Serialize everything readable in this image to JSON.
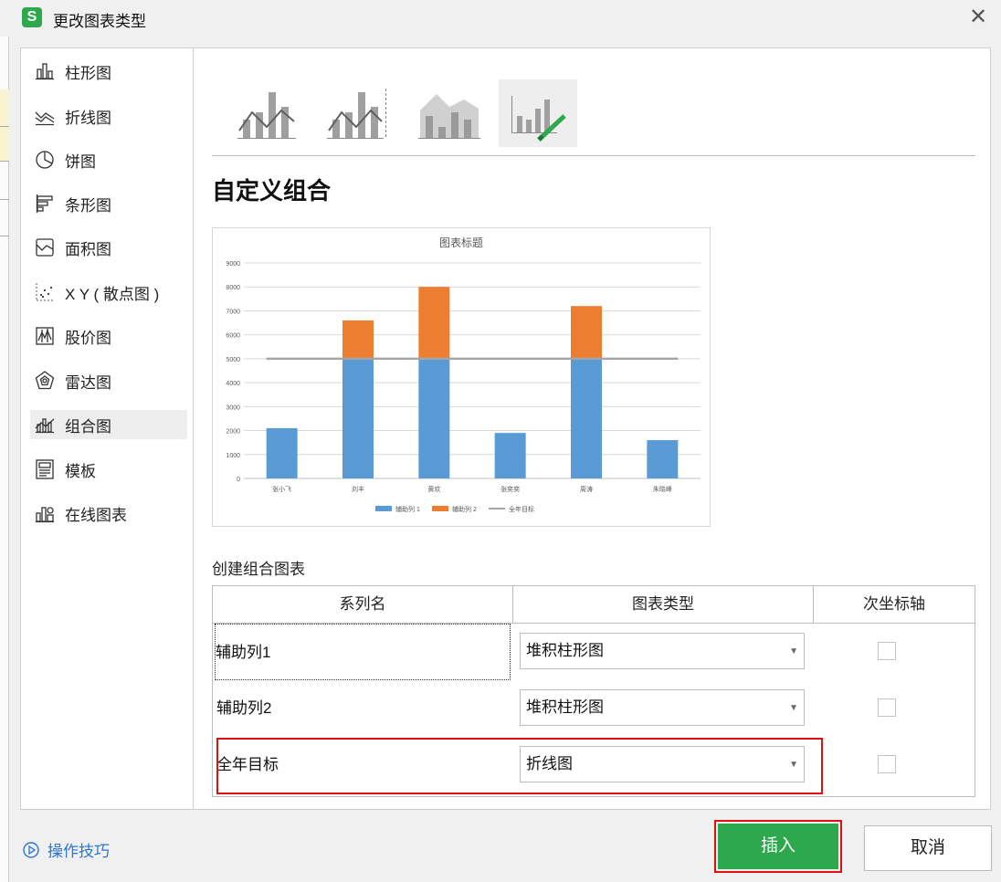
{
  "window": {
    "title": "更改图表类型",
    "app_icon": "wps-spreadsheet-icon",
    "close_icon": "close-icon"
  },
  "sidebar": {
    "items": [
      {
        "label": "柱形图",
        "icon": "column-chart-icon"
      },
      {
        "label": "折线图",
        "icon": "line-chart-icon"
      },
      {
        "label": "饼图",
        "icon": "pie-chart-icon"
      },
      {
        "label": "条形图",
        "icon": "bar-chart-icon"
      },
      {
        "label": "面积图",
        "icon": "area-chart-icon"
      },
      {
        "label": "X Y ( 散点图 )",
        "icon": "scatter-chart-icon"
      },
      {
        "label": "股价图",
        "icon": "stock-chart-icon"
      },
      {
        "label": "雷达图",
        "icon": "radar-chart-icon"
      },
      {
        "label": "组合图",
        "icon": "combo-chart-icon",
        "active": true
      },
      {
        "label": "模板",
        "icon": "template-icon"
      },
      {
        "label": "在线图表",
        "icon": "online-chart-icon"
      }
    ]
  },
  "main": {
    "subtypes": [
      {
        "icon": "combo-column-line-icon"
      },
      {
        "icon": "combo-column-line-secondary-axis-icon"
      },
      {
        "icon": "combo-area-column-icon"
      },
      {
        "icon": "custom-combo-icon",
        "selected": true
      }
    ],
    "section_title": "自定义组合",
    "create_label": "创建组合图表",
    "table": {
      "headers": [
        "系列名",
        "图表类型",
        "次坐标轴"
      ],
      "rows": [
        {
          "name": "辅助列1",
          "type": "堆积柱形图",
          "secondary_axis": false
        },
        {
          "name": "辅助列2",
          "type": "堆积柱形图",
          "secondary_axis": false
        },
        {
          "name": "全年目标",
          "type": "折线图",
          "secondary_axis": false
        }
      ]
    }
  },
  "footer": {
    "tips_label": "操作技巧",
    "insert_label": "插入",
    "cancel_label": "取消"
  },
  "colors": {
    "accent_green": "#2ea84d",
    "series1": "#5b9bd5",
    "series2": "#ed7d31",
    "target_line": "#a5a5a5",
    "highlight_red": "#e01010"
  },
  "chart_data": {
    "type": "bar",
    "title": "图表标题",
    "categories": [
      "张小飞",
      "刘丰",
      "黄欢",
      "张奕奕",
      "周涛",
      "朱晓峰"
    ],
    "series": [
      {
        "name": "辅助列 1",
        "kind": "stacked-bar",
        "values": [
          2100,
          5000,
          5000,
          1900,
          5000,
          1600
        ]
      },
      {
        "name": "辅助列 2",
        "kind": "stacked-bar",
        "values": [
          0,
          1600,
          3000,
          0,
          2200,
          0
        ]
      },
      {
        "name": "全年目标",
        "kind": "line",
        "values": [
          5000,
          5000,
          5000,
          5000,
          5000,
          5000
        ]
      }
    ],
    "ylim": [
      0,
      9000
    ],
    "yticks": [
      0,
      1000,
      2000,
      3000,
      4000,
      5000,
      6000,
      7000,
      8000,
      9000
    ],
    "ytick_labels": [
      "0",
      "1000",
      "2000",
      "3000",
      "4000",
      "5000",
      "6000",
      "7000",
      "8000",
      "9000"
    ],
    "grid": true,
    "legend": "bottom"
  }
}
